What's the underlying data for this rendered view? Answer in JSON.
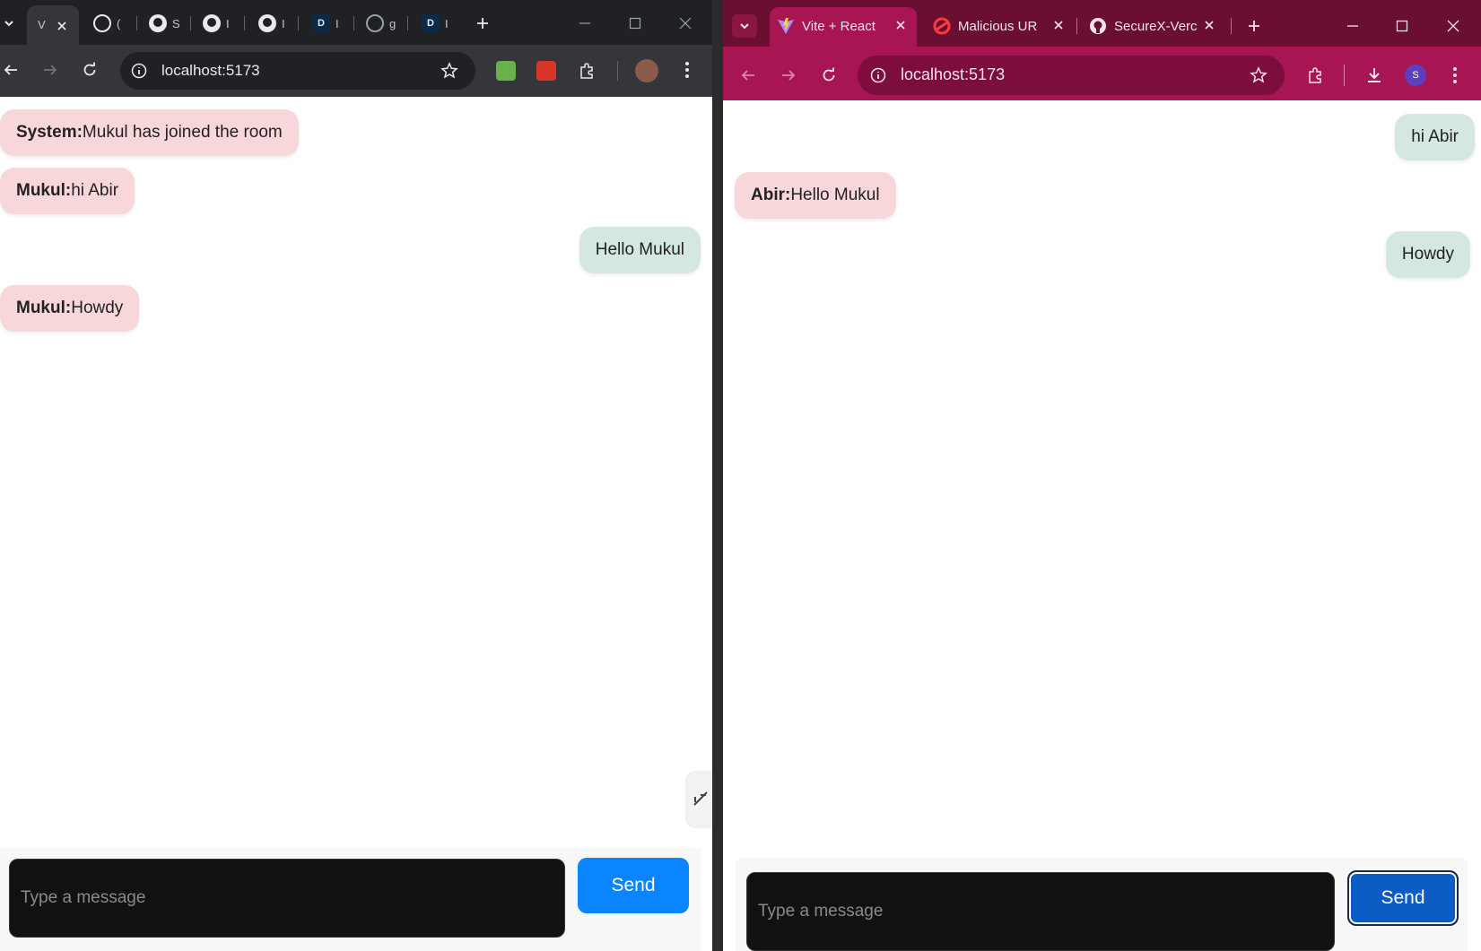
{
  "left_window": {
    "active_tab": {
      "label": "V"
    },
    "tab_overflow": [
      "(",
      "S",
      "I",
      "I",
      "I",
      "g",
      "I"
    ],
    "address": "localhost:5173",
    "messages": [
      {
        "sender": "System:",
        "text": "Mukul has joined the room",
        "direction": "incoming"
      },
      {
        "sender": "Mukul:",
        "text": "hi Abir",
        "direction": "incoming"
      },
      {
        "sender": "",
        "text": "Hello Mukul",
        "direction": "outgoing"
      },
      {
        "sender": "Mukul:",
        "text": "Howdy",
        "direction": "incoming"
      }
    ],
    "composer": {
      "placeholder": "Type a message",
      "send_label": "Send"
    }
  },
  "right_window": {
    "tabs": [
      {
        "label": "Vite + React",
        "favicon": "vite-icon",
        "active": true
      },
      {
        "label": "Malicious UR",
        "favicon": "shield-icon",
        "active": false
      },
      {
        "label": "SecureX-Verc",
        "favicon": "github-icon",
        "active": false
      }
    ],
    "address": "localhost:5173",
    "profile_initial": "S",
    "messages": [
      {
        "sender": "",
        "text": "hi Abir",
        "direction": "outgoing"
      },
      {
        "sender": "Abir:",
        "text": "Hello Mukul",
        "direction": "incoming"
      },
      {
        "sender": "",
        "text": "Howdy",
        "direction": "outgoing"
      }
    ],
    "composer": {
      "placeholder": "Type a message",
      "send_label": "Send"
    }
  },
  "colors": {
    "incoming_bubble": "#f7d7da",
    "outgoing_bubble": "#d4e8df",
    "send_left": "#0a84ff",
    "send_right": "#0b5cc4",
    "right_theme": "#a81553"
  }
}
